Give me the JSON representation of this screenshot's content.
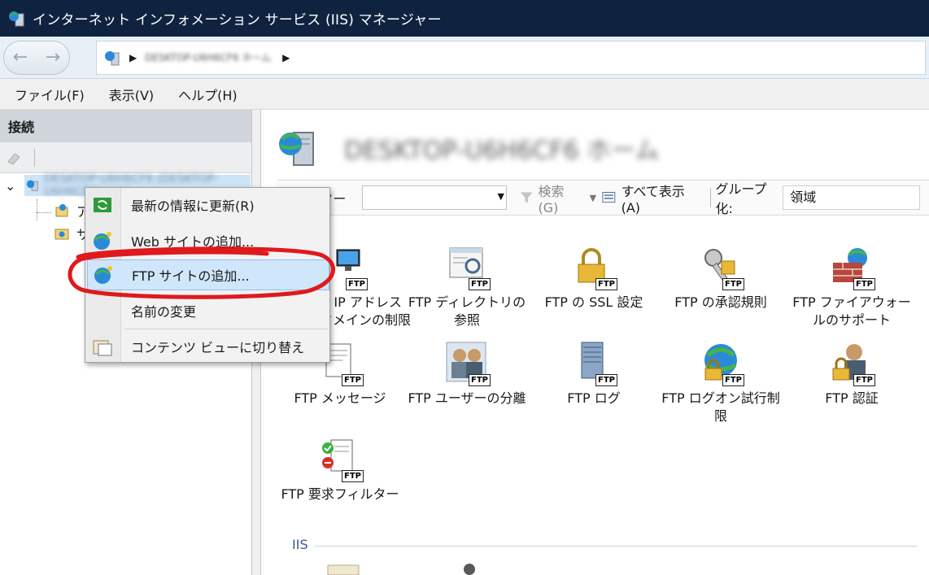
{
  "window": {
    "title": "インターネット インフォメーション サービス (IIS) マネージャー"
  },
  "address": {
    "path": "DESKTOP-U6H6CF6 ホーム"
  },
  "menu": {
    "items": [
      "ファイル(F)",
      "表示(V)",
      "ヘルプ(H)"
    ]
  },
  "connections": {
    "header": "接続",
    "server_node": "DESKTOP-U6H6CF6 (DESKTOP-U6H6CF6\\user)",
    "child1": "ア",
    "child2": "サ"
  },
  "main": {
    "server_title": "DESKTOP-U6H6CF6 ホーム",
    "filter": {
      "label": "フィルター:",
      "search": "検索(G)",
      "show_all": "すべて表示(A)",
      "group_label": "グループ化:",
      "group_value": "領域"
    },
    "tiles": [
      {
        "label": "FTP IP アドレスとドメインの制限"
      },
      {
        "label": "FTP ディレクトリの参照"
      },
      {
        "label": "FTP の SSL 設定"
      },
      {
        "label": "FTP の承認規則"
      },
      {
        "label": "FTP ファイアウォールのサポート"
      },
      {
        "label": "FTP メッセージ"
      },
      {
        "label": "FTP ユーザーの分離"
      },
      {
        "label": "FTP ログ"
      },
      {
        "label": "FTP ログオン試行制限"
      },
      {
        "label": "FTP 認証"
      },
      {
        "label": "FTP 要求フィルター"
      }
    ],
    "section_iis": "IIS"
  },
  "context_menu": {
    "items": [
      {
        "label": "最新の情報に更新(R)"
      },
      {
        "label": "Web サイトの追加..."
      },
      {
        "label": "FTP サイトの追加..."
      },
      {
        "label": "名前の変更"
      },
      {
        "label": "コンテンツ ビューに切り替え"
      }
    ]
  },
  "colors": {
    "titlebar": "#0f2340",
    "highlight": "#cfe6fb",
    "annotation": "#e0191c"
  }
}
